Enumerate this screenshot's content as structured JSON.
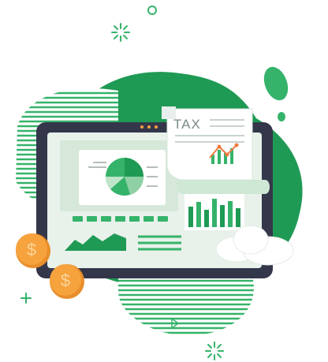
{
  "document": {
    "label": "TAX"
  },
  "palette": {
    "green_dark": "#1f9a55",
    "green_mid": "#35b36a",
    "green_light": "#cfe7d5",
    "monitor_frame": "#34364a",
    "screen_bg": "#e8f1ea",
    "coin": "#f6a23d",
    "coin_edge": "#e88e2a",
    "chart_accent": "#f07b3f"
  },
  "icons": {
    "coin_symbol": "$",
    "sparkle": "sparkle-icon",
    "plus": "plus-icon",
    "circle": "circle-icon"
  }
}
